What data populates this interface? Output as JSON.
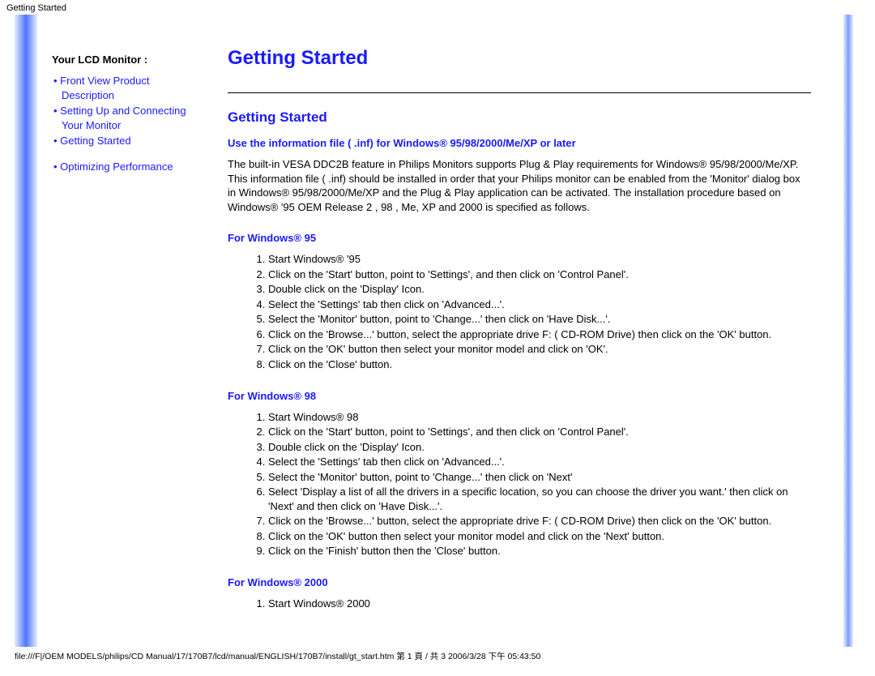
{
  "header_small": "Getting Started",
  "sidebar": {
    "title": "Your LCD Monitor :",
    "items": [
      {
        "label": "Front View Product Description"
      },
      {
        "label": "Setting Up and Connecting Your Monitor"
      },
      {
        "label": "Getting Started"
      },
      {
        "label": "Optimizing Performance"
      }
    ]
  },
  "main": {
    "title": "Getting Started",
    "section_title": "Getting Started",
    "inf_line": "Use the information file ( .inf) for Windows® 95/98/2000/Me/XP or later",
    "intro_para": "The built-in VESA DDC2B feature in Philips Monitors supports Plug & Play requirements for Windows® 95/98/2000/Me/XP. This information file ( .inf) should be installed in order that your Philips monitor can be enabled from the 'Monitor' dialog box in Windows® 95/98/2000/Me/XP and the Plug & Play application can be activated. The installation procedure based on Windows® '95 OEM Release 2 , 98 , Me, XP and 2000 is specified as follows.",
    "win95": {
      "heading": "For Windows® 95",
      "steps": [
        "Start Windows® '95",
        "Click on the 'Start' button, point to 'Settings', and then click on 'Control Panel'.",
        "Double click on the 'Display' Icon.",
        "Select the 'Settings' tab then click on 'Advanced...'.",
        "Select the 'Monitor' button, point to 'Change...' then click on 'Have Disk...'.",
        "Click on the 'Browse...' button, select the appropriate drive F: ( CD-ROM Drive) then click on the 'OK' button.",
        "Click on the 'OK' button then select your monitor model and click on 'OK'.",
        "Click on the 'Close' button."
      ]
    },
    "win98": {
      "heading": "For Windows® 98",
      "steps": [
        "Start Windows® 98",
        "Click on the 'Start' button, point to 'Settings', and then click on 'Control Panel'.",
        "Double click on the 'Display' Icon.",
        "Select the 'Settings' tab then click on 'Advanced...'.",
        "Select the 'Monitor' button, point to 'Change...' then click on 'Next'",
        "Select 'Display a list of all the drivers in a specific location, so you can choose the driver you want.' then click on 'Next' and then click on 'Have Disk...'.",
        "Click on the 'Browse...' button, select the appropriate drive F: ( CD-ROM Drive) then click on the 'OK' button.",
        "Click on the 'OK' button then select your monitor model and click on the 'Next' button.",
        "Click on the 'Finish' button then the 'Close' button."
      ]
    },
    "win2000": {
      "heading": "For Windows® 2000",
      "steps": [
        "Start Windows® 2000"
      ]
    }
  },
  "footer_path": "file:///F|/OEM MODELS/philips/CD Manual/17/170B7/lcd/manual/ENGLISH/170B7/install/gt_start.htm 第 1 頁 / 共 3 2006/3/28 下午 05:43:50"
}
